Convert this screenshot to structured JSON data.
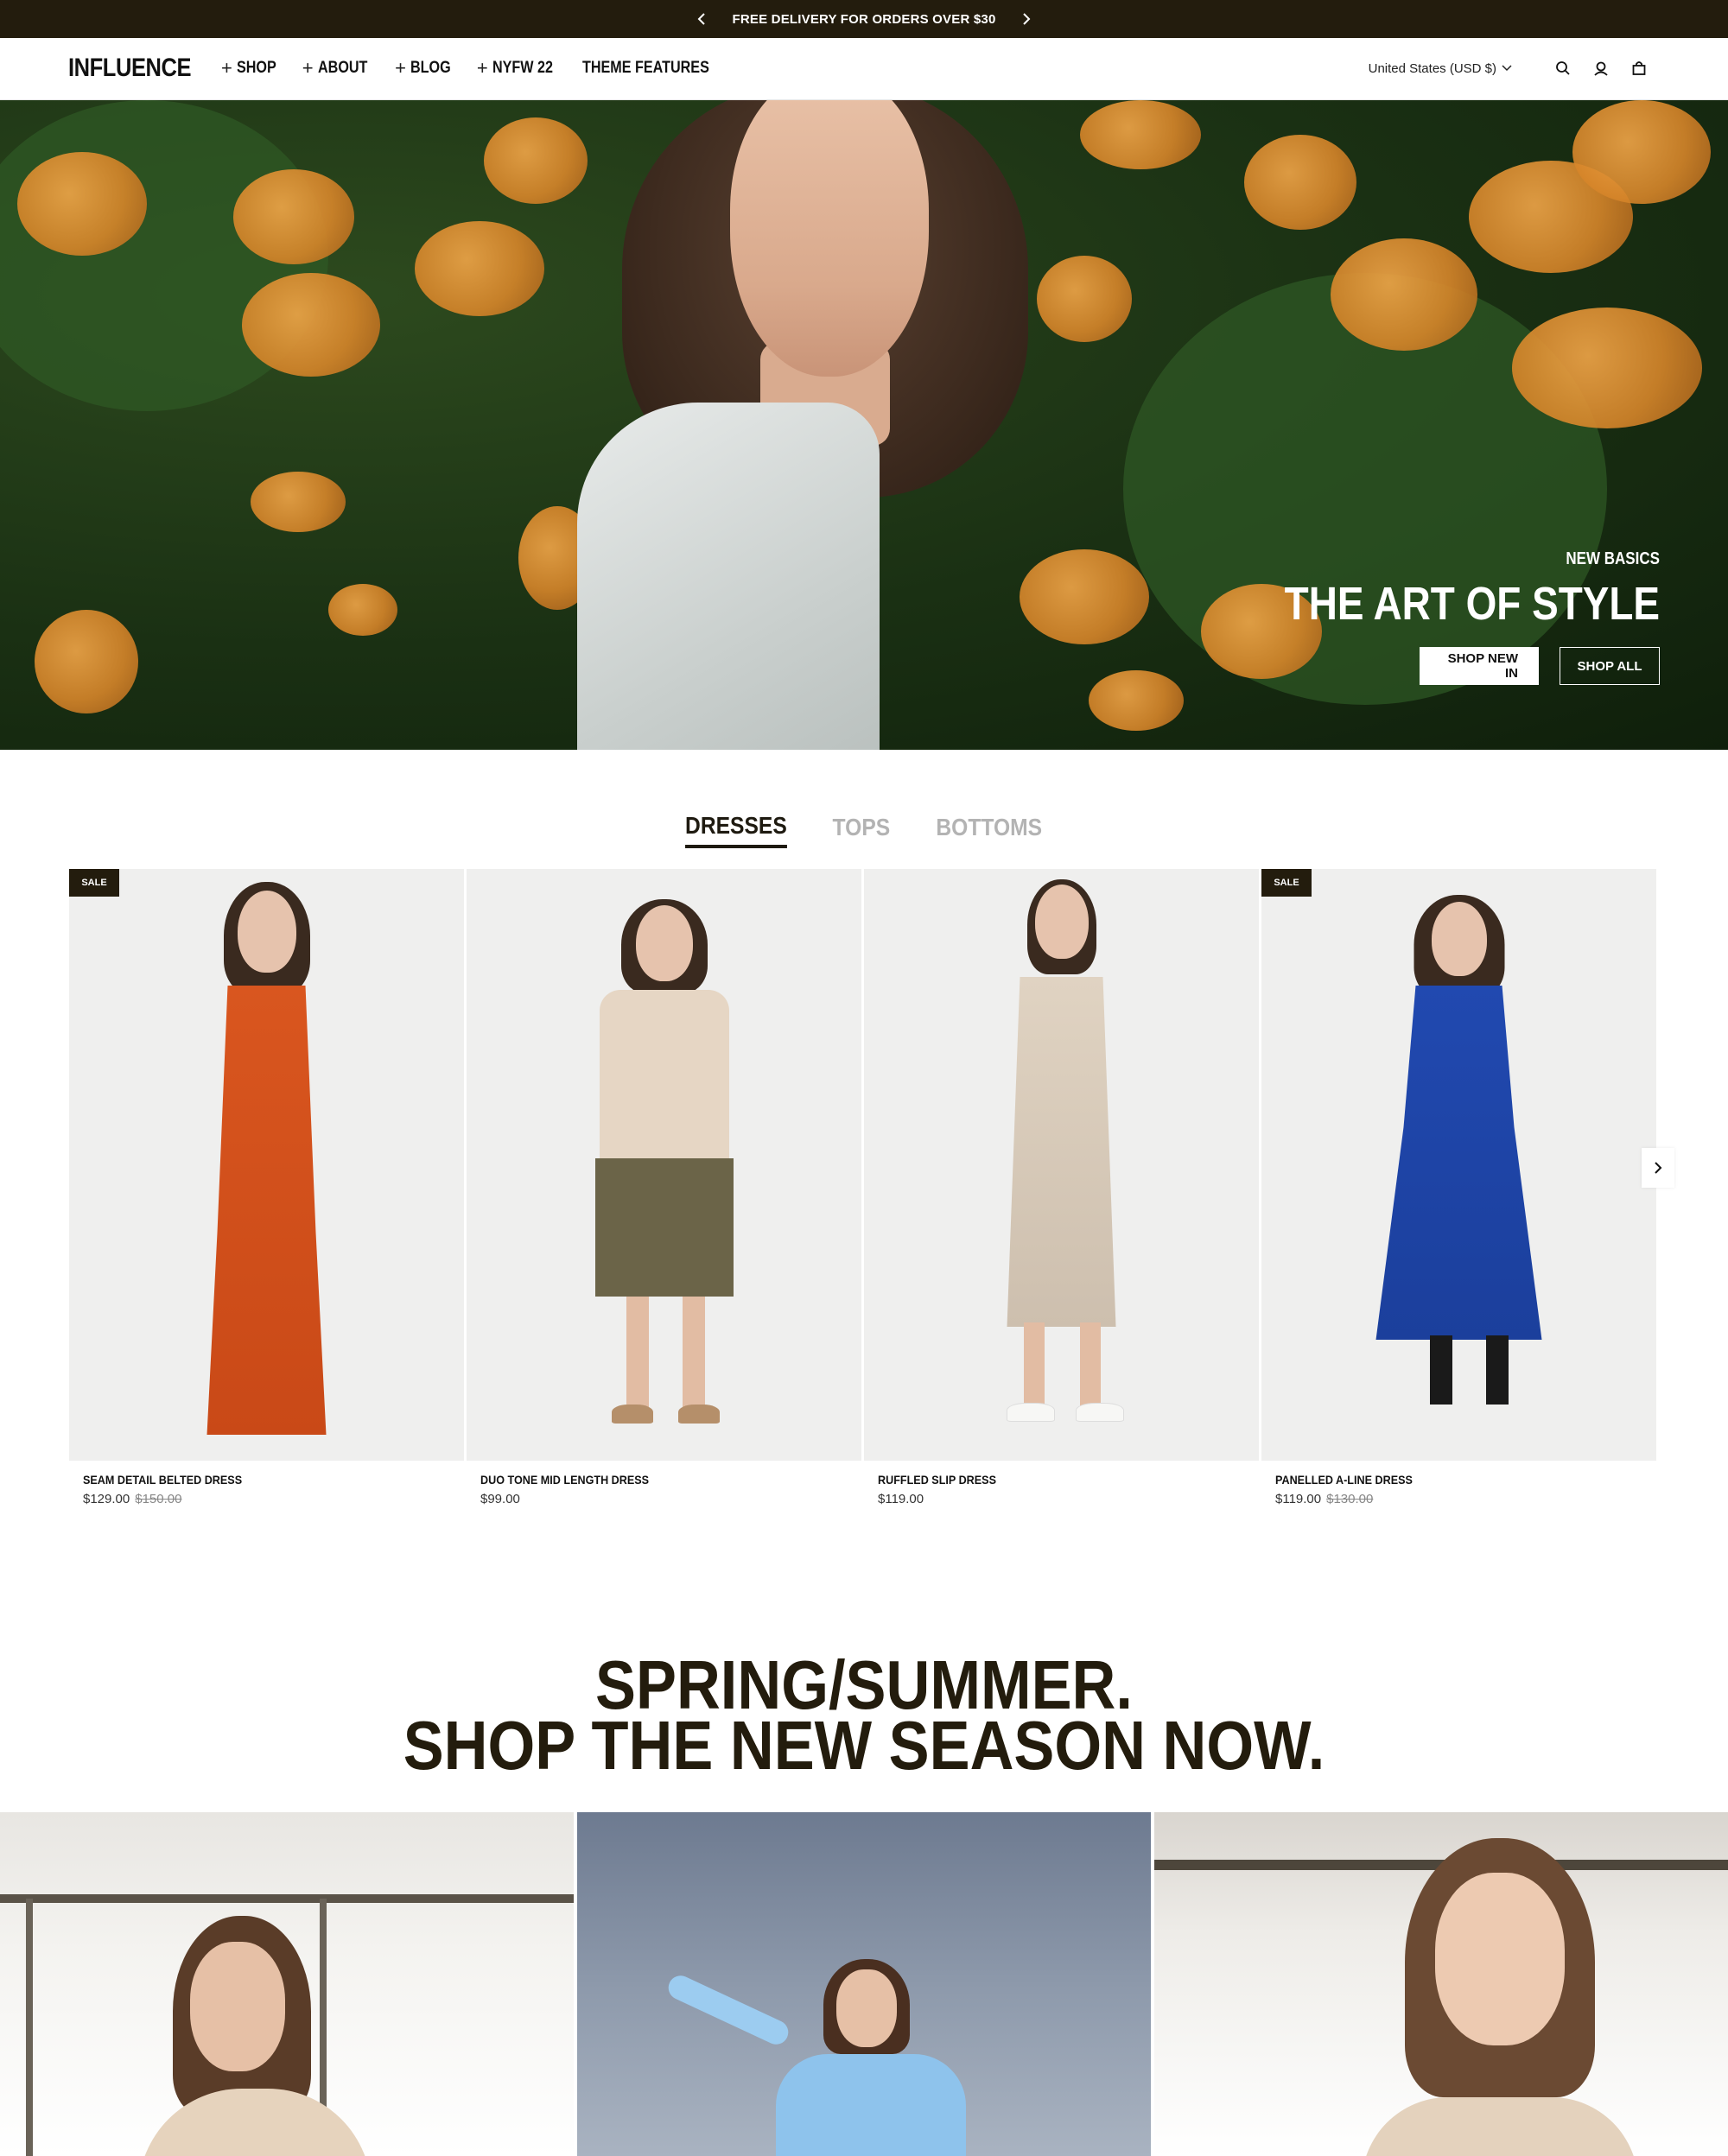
{
  "announcement": {
    "text": "FREE DELIVERY FOR ORDERS OVER $30"
  },
  "header": {
    "logo": "INFLUENCE",
    "nav": [
      {
        "label": "SHOP",
        "expandable": true
      },
      {
        "label": "ABOUT",
        "expandable": true
      },
      {
        "label": "BLOG",
        "expandable": true
      },
      {
        "label": "NYFW 22",
        "expandable": true
      },
      {
        "label": "THEME FEATURES",
        "expandable": false
      }
    ],
    "currency": "United States (USD $)",
    "icons": [
      "search-icon",
      "account-icon",
      "cart-icon"
    ]
  },
  "hero": {
    "kicker": "NEW BASICS",
    "title": "THE ART OF STYLE",
    "primary_button": "SHOP NEW IN",
    "secondary_button": "SHOP ALL"
  },
  "tabs": [
    {
      "label": "DRESSES",
      "active": true
    },
    {
      "label": "TOPS",
      "active": false
    },
    {
      "label": "BOTTOMS",
      "active": false
    }
  ],
  "products": [
    {
      "badge": "SALE",
      "name": "SEAM DETAIL BELTED DRESS",
      "price": "$129.00",
      "compare_price": "$150.00",
      "color": "#d7511f"
    },
    {
      "badge": "",
      "name": "DUO TONE MID LENGTH DRESS",
      "price": "$99.00",
      "compare_price": "",
      "color": "#e5d4c2"
    },
    {
      "badge": "",
      "name": "RUFFLED SLIP DRESS",
      "price": "$119.00",
      "compare_price": "",
      "color": "#d9ccbb"
    },
    {
      "badge": "SALE",
      "name": "PANELLED A-LINE DRESS",
      "price": "$119.00",
      "compare_price": "$130.00",
      "color": "#1f45a8"
    }
  ],
  "season": {
    "line1": "SPRING/SUMMER.",
    "line2": "SHOP THE NEW SEASON NOW."
  },
  "colors": {
    "dark": "#231c0d",
    "muted_tab": "#b3b3b3",
    "sale_badge": "#231c0d"
  }
}
